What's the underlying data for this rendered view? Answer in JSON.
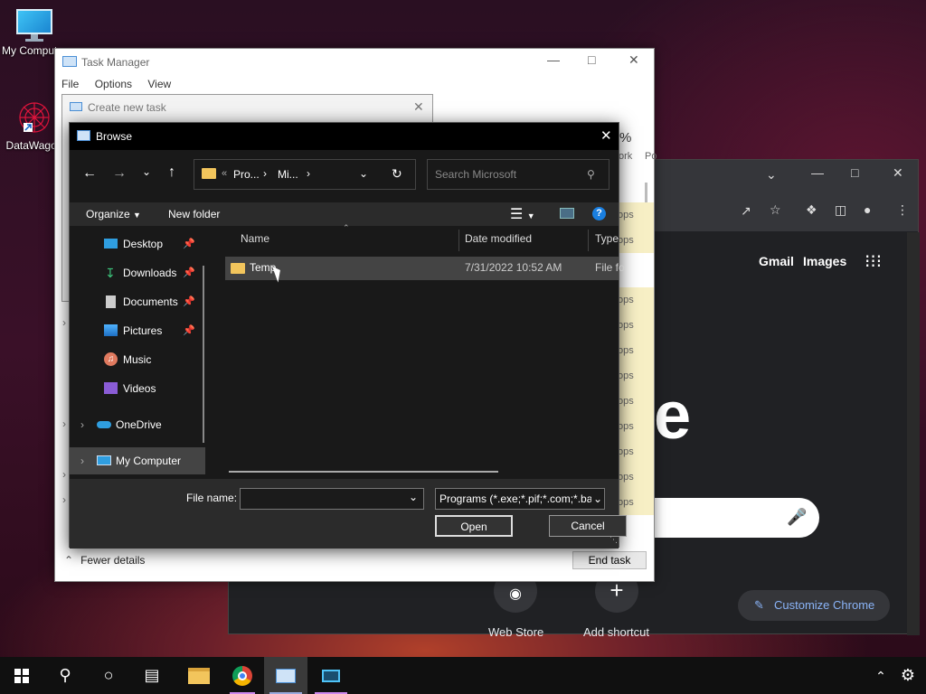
{
  "desktop": {
    "icons": [
      {
        "label": "My Computer",
        "icon": "monitor-icon"
      },
      {
        "label": "DataWagon",
        "icon": "datawagon-icon"
      }
    ]
  },
  "chrome": {
    "links": {
      "gmail": "Gmail",
      "images": "Images"
    },
    "big_letter": "e",
    "customize": "Customize Chrome",
    "shortcuts": [
      {
        "label": "Web Store",
        "icon": "chrome-webstore-icon"
      },
      {
        "label": "Add shortcut",
        "icon": "plus-icon"
      }
    ]
  },
  "task_manager": {
    "title": "Task Manager",
    "menu": [
      "File",
      "Options",
      "View"
    ],
    "percent": "%",
    "col_fragments": [
      "ork",
      "Po"
    ],
    "row_fragment": "ops",
    "fewer_details": "Fewer details",
    "end_task": "End task"
  },
  "create_new_task": {
    "title": "Create new task"
  },
  "browse": {
    "title": "Browse",
    "breadcrumb": [
      "«",
      "Pro...",
      "Mi..."
    ],
    "search_placeholder": "Search Microsoft",
    "organize": "Organize",
    "new_folder": "New folder",
    "sidebar": [
      {
        "label": "Desktop",
        "icon": "desktop-icon",
        "pinned": true
      },
      {
        "label": "Downloads",
        "icon": "download-icon",
        "pinned": true
      },
      {
        "label": "Documents",
        "icon": "documents-icon",
        "pinned": true
      },
      {
        "label": "Pictures",
        "icon": "pictures-icon",
        "pinned": true
      },
      {
        "label": "Music",
        "icon": "music-icon",
        "pinned": false
      },
      {
        "label": "Videos",
        "icon": "videos-icon",
        "pinned": false
      },
      {
        "label": "OneDrive",
        "icon": "onedrive-icon",
        "pinned": false
      },
      {
        "label": "My Computer",
        "icon": "computer-icon",
        "pinned": false
      }
    ],
    "columns": [
      "Name",
      "Date modified",
      "Type"
    ],
    "files": [
      {
        "name": "Temp",
        "date": "7/31/2022 10:52 AM",
        "type": "File fo"
      }
    ],
    "file_name_label": "File name:",
    "file_name_value": "",
    "file_type": "Programs (*.exe;*.pif;*.com;*.ba",
    "open": "Open",
    "cancel": "Cancel"
  },
  "colors": {
    "accent": "#0078d7",
    "dialog_bg": "#191919",
    "selection": "#444444"
  }
}
